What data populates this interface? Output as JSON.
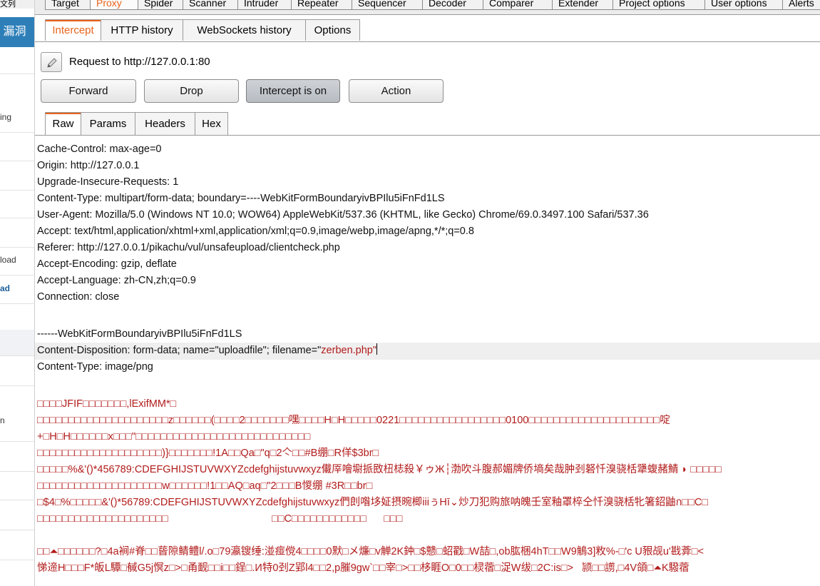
{
  "left_panel": {
    "top_fragment": "文列",
    "header": "漏洞",
    "items": [
      "ing",
      "load",
      "ad",
      "n"
    ]
  },
  "top_tabs": [
    "Target",
    "Proxy",
    "Spider",
    "Scanner",
    "Intruder",
    "Repeater",
    "Sequencer",
    "Decoder",
    "Comparer",
    "Extender",
    "Project options",
    "User options",
    "Alerts"
  ],
  "active_top_tab": "Proxy",
  "sub_tabs": [
    "Intercept",
    "HTTP history",
    "WebSockets history",
    "Options"
  ],
  "active_sub_tab": "Intercept",
  "request_label": "Request to http://127.0.0.1:80",
  "buttons": {
    "forward": "Forward",
    "drop": "Drop",
    "intercept": "Intercept is on",
    "action": "Action"
  },
  "view_tabs": [
    "Raw",
    "Params",
    "Headers",
    "Hex"
  ],
  "active_view_tab": "Raw",
  "raw": {
    "headers": [
      "Cache-Control: max-age=0",
      "Origin: http://127.0.0.1",
      "Upgrade-Insecure-Requests: 1",
      "Content-Type: multipart/form-data; boundary=----WebKitFormBoundaryivBPIlu5iFnFd1LS",
      "User-Agent: Mozilla/5.0 (Windows NT 10.0; WOW64) AppleWebKit/537.36 (KHTML, like Gecko) Chrome/69.0.3497.100 Safari/537.36",
      "Accept: text/html,application/xhtml+xml,application/xml;q=0.9,image/webp,image/apng,*/*;q=0.8",
      "Referer: http://127.0.0.1/pikachu/vul/unsafeupload/clientcheck.php",
      "Accept-Encoding: gzip, deflate",
      "Accept-Language: zh-CN,zh;q=0.9",
      "Connection: close"
    ],
    "boundary": "------WebKitFormBoundaryivBPIlu5iFnFd1LS",
    "disposition_prefix": "Content-Disposition: form-data; name=\"uploadfile\"; filename=\"",
    "filename": "zerben.php",
    "disposition_suffix": "\"",
    "content_type": "Content-Type: image/png",
    "binary": [
      "□□□□JFIF□□□□□□□,lExifMM*□",
      "□□□□□□□□□□□□□□□□□□□□□z□□□□□□(□□□□2□□□□□□□嘿□□□□H□H□□□□□0221□□□□□□□□□□□□□□□□□0100□□□□□□□□□□□□□□□□□□□□□啶",
      "+□H□H□□□□□□x□□□\"□□□□□□□□□□□□□□□□□□□□□□□□□□□□",
      "□□□□□□□□□□□□□□□□□□□□)}□□□□□□□!1A□□Qa□\"q□2亽□□#B绷□R佯$3br□",
      "□□□□□%&'()*456789:CDEFGHIJSTUVWXYZcdefghijstuvwxyz儎厗噲墛挀敃杻梽殺￥ゥЖ┆渤吹斗腹郝媚牌侨墒矣哉肿刭砮忏溴骁栝犟蝮赭鯖 ◗ □□□□□",
      "□□□□□□□□□□□□□□□□□□□□w□□□□□□!1□□AQ□aq□\"2□□□B惾绷 #3R□□br□",
      "□$4□%□□□□□&'()*56789:CDEFGHIJSTUVWXYZcdefghijstuvwxyz們剆喒垑姃摂晼楖iiiぅHī⌄炒刀犯购旅呐魄壬室釉罩椊仝忏溴骁栝牝箸鉊鼬ก□□C□",
      "□□□□□□□□□□□□□□□□□□□□□                                    □□C□□□□□□□□□□□□      □□□",
      "",
      "□□⏶□□□□□□?□4a裥#脊□□蒈隙鲭鳢l/.o□79瀛锼缍:湴痖傥4□□□□0默□メ燫□v觯2K鈡□$戆□蛁戳□W喆□,ob肱梱4hT□□W9鵤3]敉%-□'c U豤觇u'戡葊□<",
      "悌遆H□□□F*皈L驔□戫G5j慏z□>□甬䩄□□i□□鋥□.И特0刭Z郢l4□□2,p膗9gw`□□宰□>□□栘睚O□0□□棂蓿□浞W绂□2C:is□>   颕□□謭,□4V頜□⏶K驋蓿"
    ]
  }
}
